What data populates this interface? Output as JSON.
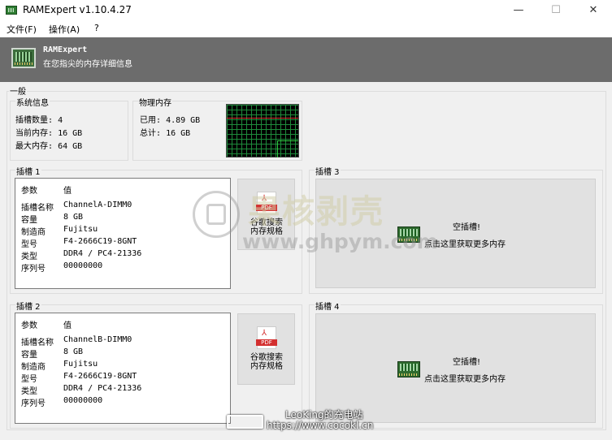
{
  "window": {
    "title": "RAMExpert v1.10.4.27",
    "min": "—",
    "max": "☐",
    "close": "✕"
  },
  "menu": {
    "file": "文件(F)",
    "actions": "操作(A)",
    "help": "?"
  },
  "banner": {
    "title": "RAMExpert",
    "subtitle": "在您指尖的内存详细信息"
  },
  "general": {
    "label": "一般",
    "system": {
      "label": "系统信息",
      "rows": [
        {
          "k": "插槽数量:",
          "v": "4"
        },
        {
          "k": "当前内存:",
          "v": "16 GB"
        },
        {
          "k": "最大内存:",
          "v": "64 GB"
        }
      ]
    },
    "physical": {
      "label": "物理内存",
      "rows": [
        {
          "k": "已用:",
          "v": "4.89 GB"
        },
        {
          "k": "总计:",
          "v": "16 GB"
        }
      ]
    }
  },
  "table_header": {
    "param": "参数",
    "value": "值"
  },
  "slots": [
    {
      "label": "插槽 1",
      "rows": [
        {
          "k": "插槽名称",
          "v": "ChannelA-DIMM0"
        },
        {
          "k": "容量",
          "v": "8 GB"
        },
        {
          "k": "制造商",
          "v": "Fujitsu"
        },
        {
          "k": "型号",
          "v": "F4-2666C19-8GNT"
        },
        {
          "k": "类型",
          "v": "DDR4 / PC4-21336"
        },
        {
          "k": "序列号",
          "v": "00000000"
        }
      ],
      "pdf": {
        "icon_text": "PDF",
        "line1": "谷歌搜索",
        "line2": "内存规格"
      }
    },
    {
      "label": "插槽 2",
      "rows": [
        {
          "k": "插槽名称",
          "v": "ChannelB-DIMM0"
        },
        {
          "k": "容量",
          "v": "8 GB"
        },
        {
          "k": "制造商",
          "v": "Fujitsu"
        },
        {
          "k": "型号",
          "v": "F4-2666C19-8GNT"
        },
        {
          "k": "类型",
          "v": "DDR4 / PC4-21336"
        },
        {
          "k": "序列号",
          "v": "00000000"
        }
      ],
      "pdf": {
        "icon_text": "PDF",
        "line1": "谷歌搜索",
        "line2": "内存规格"
      }
    },
    {
      "label": "插槽 3",
      "empty_title": "空插槽!",
      "empty_link": "点击这里获取更多内存"
    },
    {
      "label": "插槽 4",
      "empty_title": "空插槽!",
      "empty_link": "点击这里获取更多内存"
    }
  ],
  "watermark": {
    "title": "果核剥壳",
    "url": "www.ghpym.com",
    "line1": "LeoKing的充电站",
    "line2": "https://www.cocokl.cn"
  },
  "colors": {
    "banner": "#6c6c6c",
    "graph_bg": "#000000",
    "graph_grid": "#1e8b3b",
    "graph_limit": "#dd3333",
    "graph_usage": "#2ecc40"
  }
}
